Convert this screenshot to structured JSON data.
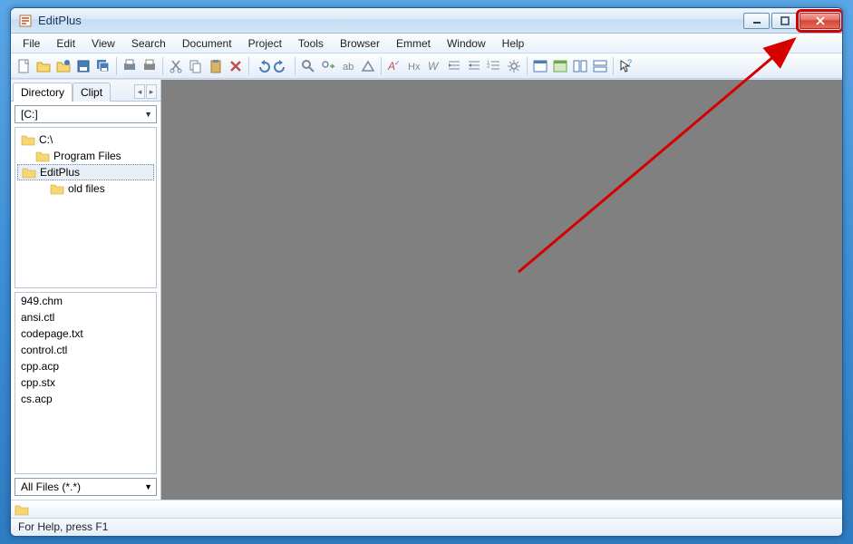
{
  "title": "EditPlus",
  "menus": [
    "File",
    "Edit",
    "View",
    "Search",
    "Document",
    "Project",
    "Tools",
    "Browser",
    "Emmet",
    "Window",
    "Help"
  ],
  "sidebar": {
    "tabs": [
      "Directory",
      "Clipt"
    ],
    "drive": "[C:]",
    "tree": [
      {
        "label": "C:\\",
        "indent": 0,
        "sel": false
      },
      {
        "label": "Program Files",
        "indent": 1,
        "sel": false
      },
      {
        "label": "EditPlus",
        "indent": 2,
        "sel": true
      },
      {
        "label": "old files",
        "indent": 2,
        "sel": false
      }
    ],
    "files": [
      "949.chm",
      "ansi.ctl",
      "codepage.txt",
      "control.ctl",
      "cpp.acp",
      "cpp.stx",
      "cs.acp"
    ],
    "filter": "All Files (*.*)"
  },
  "status": "For Help, press F1",
  "toolbar_icons": [
    "new-file",
    "open-file",
    "open-remote",
    "save",
    "save-all",
    "",
    "print-preview",
    "print",
    "",
    "cut",
    "copy",
    "paste",
    "delete",
    "",
    "undo",
    "redo",
    "",
    "find",
    "find-next",
    "replace",
    "go-to",
    "",
    "spell-check",
    "header",
    "wrap",
    "indent",
    "outdent",
    "line-number",
    "settings",
    "",
    "window-1",
    "window-2",
    "window-3",
    "window-4",
    "",
    "help-cursor"
  ]
}
